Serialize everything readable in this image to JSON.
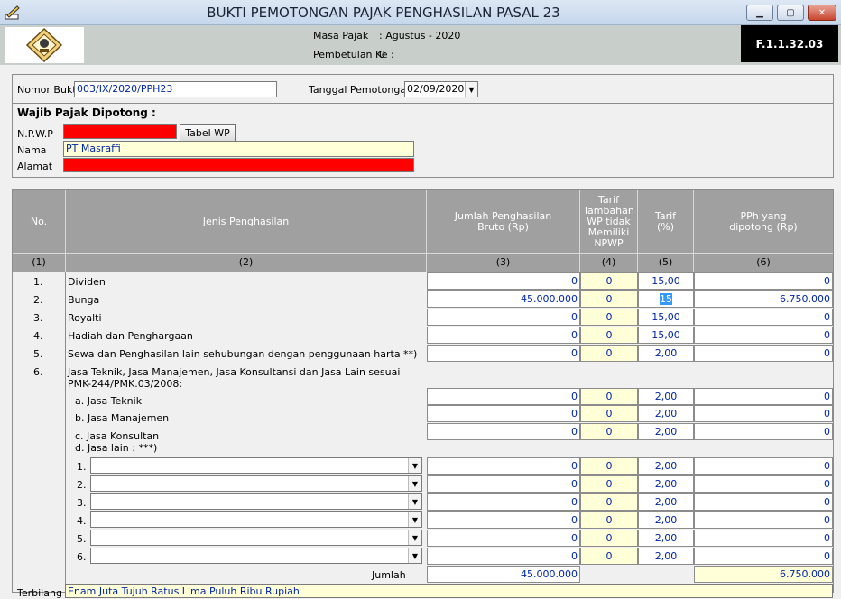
{
  "window": {
    "title": "BUKTI PEMOTONGAN PAJAK PENGHASILAN PASAL 23"
  },
  "header": {
    "masa_label": "Masa Pajak",
    "masa_value": ":   Agustus - 2020",
    "pembetulan_label": "Pembetulan Ke :",
    "pembetulan_value": "0",
    "form_code": "F.1.1.32.03"
  },
  "form": {
    "nomor_bukti_label": "Nomor Bukti",
    "nomor_bukti_value": "003/IX/2020/PPH23",
    "tanggal_label": "Tanggal Pemotongan",
    "tanggal_value": "02/09/2020",
    "wp_heading": "Wajib Pajak Dipotong :",
    "npwp_label": "N.P.W.P",
    "tabel_wp_label": "Tabel WP",
    "nama_label": "Nama",
    "nama_value": "PT Masraffi",
    "alamat_label": "Alamat"
  },
  "table": {
    "headers": {
      "no": "No.",
      "jenis": "Jenis Penghasilan",
      "bruto": "Jumlah Penghasilan Bruto (Rp)",
      "tambahan": "Tarif Tambahan WP tidak Memiliki NPWP",
      "tarif": "Tarif (%)",
      "pph": "PPh yang dipotong (Rp)"
    },
    "col_numbers": [
      "(1)",
      "(2)",
      "(3)",
      "(4)",
      "(5)",
      "(6)"
    ],
    "rows": [
      {
        "no": "1.",
        "label": "Dividen",
        "bruto": "0",
        "tambahan": "0",
        "tarif": "15,00",
        "pph": "0"
      },
      {
        "no": "2.",
        "label": "Bunga",
        "bruto": "45.000.000",
        "tambahan": "0",
        "tarif": "15",
        "pph": "6.750.000"
      },
      {
        "no": "3.",
        "label": "Royalti",
        "bruto": "0",
        "tambahan": "0",
        "tarif": "15,00",
        "pph": "0"
      },
      {
        "no": "4.",
        "label": "Hadiah dan Penghargaan",
        "bruto": "0",
        "tambahan": "0",
        "tarif": "15,00",
        "pph": "0"
      },
      {
        "no": "5.",
        "label": "Sewa dan Penghasilan lain sehubungan dengan penggunaan harta **)",
        "bruto": "0",
        "tambahan": "0",
        "tarif": "2,00",
        "pph": "0"
      }
    ],
    "row6": {
      "no": "6.",
      "label_line1": "Jasa Teknik, Jasa Manajemen,  Jasa Konsultansi dan Jasa Lain sesuai",
      "label_line2": "PMK-244/PMK.03/2008:"
    },
    "jasa_rows": [
      {
        "label": "a. Jasa Teknik",
        "bruto": "0",
        "tambahan": "0",
        "tarif": "2,00",
        "pph": "0"
      },
      {
        "label": "b. Jasa Manajemen",
        "bruto": "0",
        "tambahan": "0",
        "tarif": "2,00",
        "pph": "0"
      },
      {
        "label": "c. Jasa Konsultan",
        "bruto": "0",
        "tambahan": "0",
        "tarif": "2,00",
        "pph": "0"
      }
    ],
    "jasa_lain_label": "d. Jasa lain : ***)",
    "lain_rows": [
      {
        "no": "1.",
        "bruto": "0",
        "tambahan": "0",
        "tarif": "2,00",
        "pph": "0"
      },
      {
        "no": "2.",
        "bruto": "0",
        "tambahan": "0",
        "tarif": "2,00",
        "pph": "0"
      },
      {
        "no": "3.",
        "bruto": "0",
        "tambahan": "0",
        "tarif": "2,00",
        "pph": "0"
      },
      {
        "no": "4.",
        "bruto": "0",
        "tambahan": "0",
        "tarif": "2,00",
        "pph": "0"
      },
      {
        "no": "5.",
        "bruto": "0",
        "tambahan": "0",
        "tarif": "2,00",
        "pph": "0"
      },
      {
        "no": "6.",
        "bruto": "0",
        "tambahan": "0",
        "tarif": "2,00",
        "pph": "0"
      }
    ],
    "jumlah_label": "Jumlah",
    "jumlah_bruto": "45.000.000",
    "jumlah_pph": "6.750.000"
  },
  "terbilang": {
    "label": "Terbilang",
    "value": "Enam Juta Tujuh Ratus Lima Puluh Ribu Rupiah"
  }
}
